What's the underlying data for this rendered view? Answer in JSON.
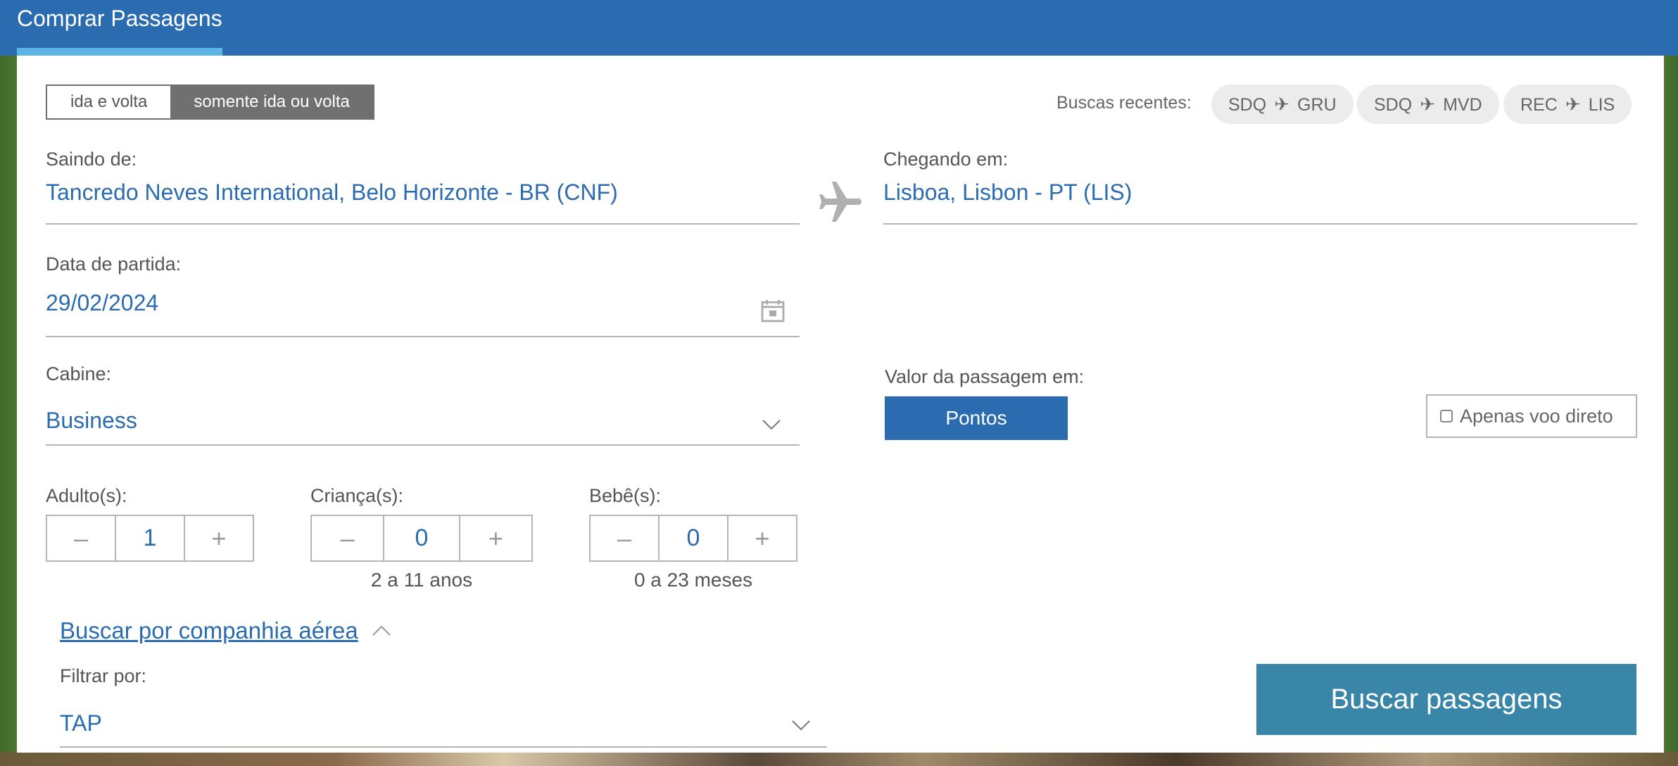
{
  "header": {
    "title": "Comprar Passagens"
  },
  "trip_type": {
    "options": [
      "ida e volta",
      "somente ida ou volta"
    ],
    "selected": "somente ida ou volta"
  },
  "recent_searches": {
    "label": "Buscas recentes:",
    "items": [
      {
        "from": "SDQ",
        "to": "GRU"
      },
      {
        "from": "SDQ",
        "to": "MVD"
      },
      {
        "from": "REC",
        "to": "LIS"
      }
    ]
  },
  "origin": {
    "label": "Saindo de:",
    "value": "Tancredo Neves International, Belo Horizonte - BR (CNF)"
  },
  "destination": {
    "label": "Chegando em:",
    "value": "Lisboa, Lisbon - PT (LIS)"
  },
  "departure": {
    "label": "Data de partida:",
    "value": "29/02/2024"
  },
  "cabin": {
    "label": "Cabine:",
    "value": "Business"
  },
  "fare": {
    "label": "Valor da passagem em:",
    "button": "Pontos"
  },
  "direct_only": {
    "label": "Apenas voo direto",
    "checked": false
  },
  "passengers": {
    "adults": {
      "label": "Adulto(s):",
      "value": "1"
    },
    "children": {
      "label": "Criança(s):",
      "value": "0",
      "hint": "2 a 11 anos"
    },
    "infants": {
      "label": "Bebê(s):",
      "value": "0",
      "hint": "0 a 23 meses"
    },
    "minus": "–",
    "plus": "+"
  },
  "airline": {
    "toggle": "Buscar por companhia aérea",
    "filter_label": "Filtrar por:",
    "filter_value": "TAP"
  },
  "search_button": "Buscar passagens",
  "colors": {
    "primary": "#2b6cb0",
    "search": "#3a86a8",
    "accent": "#5ab4e6"
  }
}
